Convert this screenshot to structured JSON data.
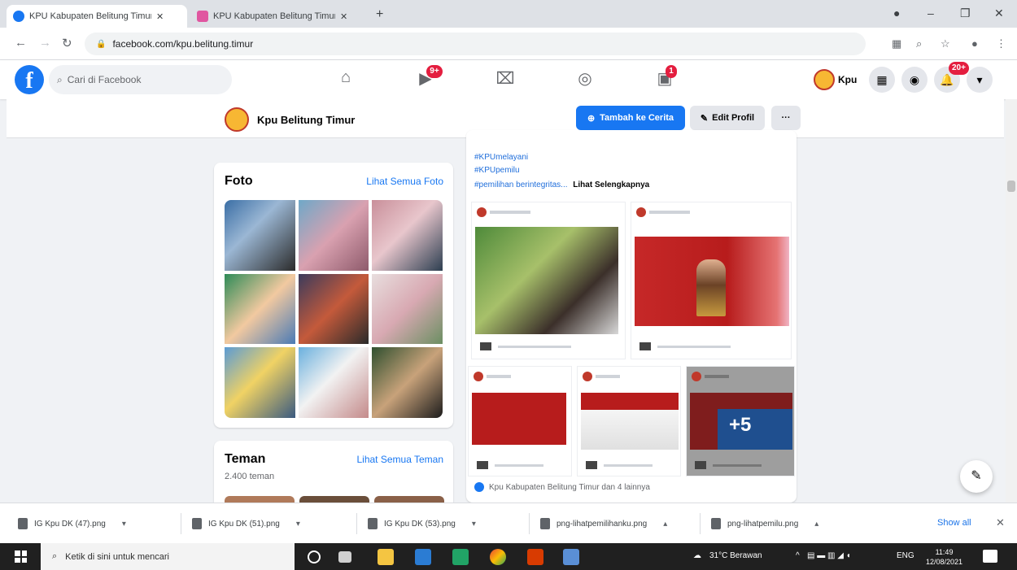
{
  "browser": {
    "tabs": [
      {
        "label": "KPU Kabupaten Belitung Timur | Beranda",
        "favicon_color": "#1877f2",
        "active": true
      },
      {
        "label": "KPU Kabupaten Belitung Timur",
        "favicon_color": "#e056a0",
        "active": false
      }
    ],
    "new_tab_symbol": "+",
    "url": "facebook.com/kpu.belitung.timur",
    "window_controls": {
      "minimize": "–",
      "restore": "❐",
      "close": "✕"
    }
  },
  "facebook": {
    "logo": "f",
    "search_placeholder": "Cari di Facebook",
    "nav_badges": {
      "watch": "9+",
      "groups": "1"
    },
    "profile_short_name": "Kpu",
    "notifications_badge": "20+",
    "page": {
      "name": "Kpu Belitung Timur",
      "primary_button": "Tambah ke Cerita",
      "edit_button": "Edit Profil",
      "more_button": "···"
    },
    "photos_card": {
      "title": "Foto",
      "see_all": "Lihat Semua Foto"
    },
    "friends_card": {
      "title": "Teman",
      "see_all": "Lihat Semua Teman",
      "count": "2.400 teman"
    },
    "post": {
      "hashtags": [
        "#KPUmelayani",
        "#KPUpemilu"
      ],
      "more_line": "#pemilihan berintegritas...",
      "see_more": "Lihat Selengkapnya",
      "extra_photos": "+5",
      "reactions": "Kpu Kabupaten Belitung Timur dan 4 lainnya"
    },
    "compose_icon": "compose-message-icon"
  },
  "downloads": {
    "items": [
      "IG Kpu DK (47).png",
      "IG Kpu DK (51).png",
      "IG Kpu DK (53).png",
      "png-lihatpemilihanku.png",
      "png-lihatpemilu.png"
    ],
    "show_all": "Show all",
    "close": "✕"
  },
  "taskbar": {
    "search_placeholder": "Ketik di sini untuk mencari",
    "weather": "31°C Berawan",
    "language": "ENG",
    "time": "11:49",
    "date": "12/08/2021"
  },
  "colors": {
    "facebook_blue": "#1877f2",
    "badge_red": "#e41e3f",
    "kpu_red": "#b71c1c"
  }
}
